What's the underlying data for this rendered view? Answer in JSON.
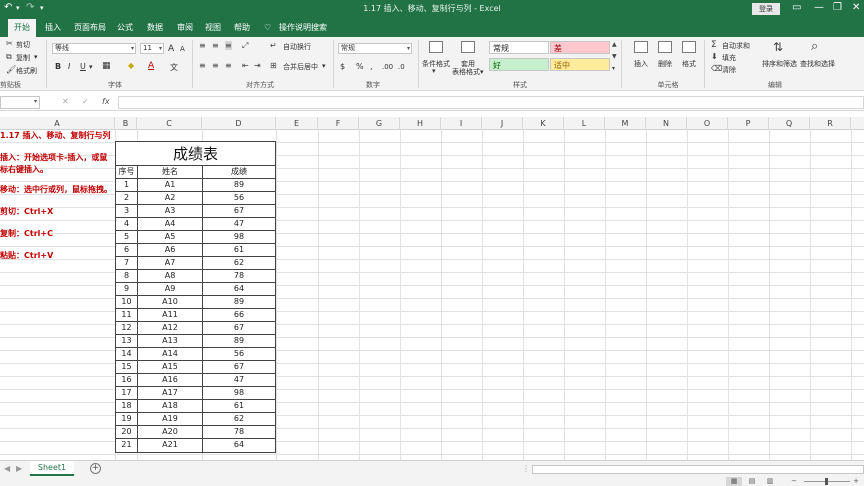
{
  "titlebar": {
    "title": "1.17 插入、移动、复制行与列  -  Excel",
    "login_label": "登录",
    "undo_icon": "↶",
    "redo_icon": "↷",
    "qat_more": "▾",
    "ribbon_display_icon": "▭",
    "minimize": "—",
    "restore": "❐",
    "close": "✕"
  },
  "tabs": [
    {
      "label": "开始",
      "active": true
    },
    {
      "label": "插入"
    },
    {
      "label": "页面布局"
    },
    {
      "label": "公式"
    },
    {
      "label": "数据"
    },
    {
      "label": "审阅"
    },
    {
      "label": "视图"
    },
    {
      "label": "帮助"
    }
  ],
  "tell_me": {
    "icon": "♡",
    "label": "操作说明搜索"
  },
  "ribbon": {
    "clipboard": {
      "cut": "剪切",
      "copy": "复制",
      "copy_arrow": "▾",
      "format_painter": "格式刷",
      "group": "剪贴板"
    },
    "font": {
      "name": "等线",
      "size": "11",
      "grow": "A",
      "shrink": "A",
      "bold": "B",
      "italic": "I",
      "underline": "U",
      "underline_arrow": "▾",
      "border_icon": "▦",
      "fill_icon": "◆",
      "font_color_icon": "A",
      "wen_icon": "文",
      "group": "字体"
    },
    "alignment": {
      "wrap_text": "自动换行",
      "merge_center": "合并后居中",
      "merge_arrow": "▾",
      "group": "对齐方式"
    },
    "number": {
      "format": "常规",
      "currency": "$",
      "percent": "%",
      "comma": ",",
      "inc_dec": ".00",
      "dec_dec": ".0",
      "group": "数字"
    },
    "styles": {
      "conditional": "条件格式",
      "conditional_arrow": "▾",
      "table": "套用\n表格格式",
      "table_line1": "套用",
      "table_line2": "表格格式▾",
      "normal": "常规",
      "bad": "差",
      "good": "好",
      "neutral": "适中",
      "group": "样式",
      "colors": {
        "bad_bg": "#ffc7ce",
        "bad_fg": "#9c0006",
        "good_bg": "#c6efce",
        "good_fg": "#006100",
        "neutral_bg": "#ffeb9c",
        "neutral_fg": "#9c6500"
      }
    },
    "cells": {
      "insert": "插入",
      "delete": "删除",
      "format": "格式",
      "group": "单元格"
    },
    "editing": {
      "autosum": "自动求和",
      "fill": "填充",
      "clear": "清除",
      "sort_filter": "排序和筛选",
      "find_select": "查找和选择",
      "group": "编辑"
    }
  },
  "formula_bar": {
    "cancel": "✕",
    "enter": "✓",
    "fx": "fx",
    "namebox_arrow": "▾"
  },
  "columns": [
    "A",
    "B",
    "C",
    "D",
    "E",
    "F",
    "G",
    "H",
    "I",
    "J",
    "K",
    "L",
    "M",
    "N",
    "O",
    "P",
    "Q",
    "R"
  ],
  "notes": [
    "1.17 插入、移动、复制行与列",
    "插入：开始选项卡-插入，或鼠",
    "标右键插入。",
    "移动：选中行或列，鼠标拖拽。",
    "剪切：Ctrl+X",
    "复制：Ctrl+C",
    "粘贴：Ctrl+V"
  ],
  "table": {
    "title": "成绩表",
    "headers": [
      "序号",
      "姓名",
      "成绩"
    ],
    "rows": [
      [
        "1",
        "A1",
        "89"
      ],
      [
        "2",
        "A2",
        "56"
      ],
      [
        "3",
        "A3",
        "67"
      ],
      [
        "4",
        "A4",
        "47"
      ],
      [
        "5",
        "A5",
        "98"
      ],
      [
        "6",
        "A6",
        "61"
      ],
      [
        "7",
        "A7",
        "62"
      ],
      [
        "8",
        "A8",
        "78"
      ],
      [
        "9",
        "A9",
        "64"
      ],
      [
        "10",
        "A10",
        "89"
      ],
      [
        "11",
        "A11",
        "66"
      ],
      [
        "12",
        "A12",
        "67"
      ],
      [
        "13",
        "A13",
        "89"
      ],
      [
        "14",
        "A14",
        "56"
      ],
      [
        "15",
        "A15",
        "67"
      ],
      [
        "16",
        "A16",
        "47"
      ],
      [
        "17",
        "A17",
        "98"
      ],
      [
        "18",
        "A18",
        "61"
      ],
      [
        "19",
        "A19",
        "62"
      ],
      [
        "20",
        "A20",
        "78"
      ],
      [
        "21",
        "A21",
        "64"
      ]
    ]
  },
  "sheetbar": {
    "sheet_name": "Sheet1",
    "add_icon": "+",
    "prev": "◀",
    "next": "▶"
  },
  "statusbar": {
    "normal_view": "▦",
    "page_layout": "▤",
    "page_break": "▥",
    "zoom_minus": "−",
    "zoom_plus": "+"
  },
  "colors": {
    "accent": "#217346",
    "note_red": "#c00000"
  }
}
